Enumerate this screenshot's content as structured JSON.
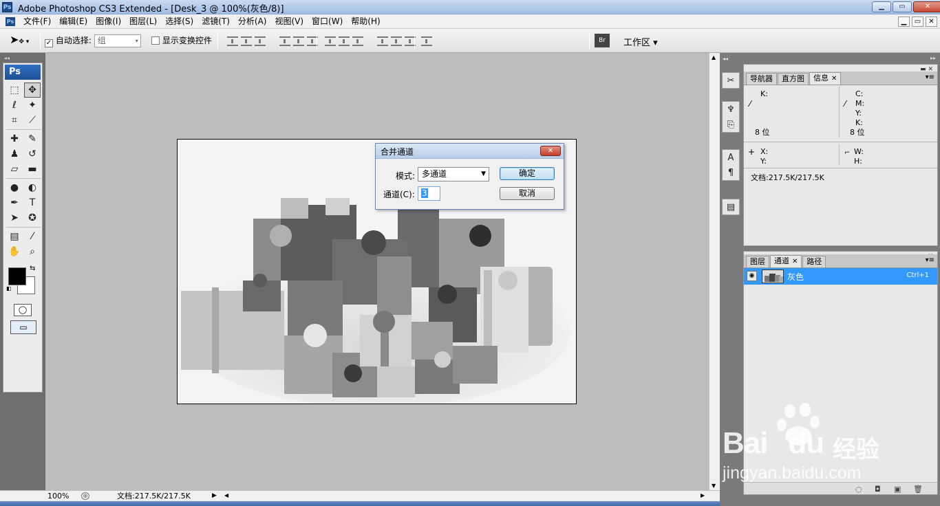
{
  "window": {
    "title": "Adobe Photoshop CS3 Extended - [Desk_3 @ 100%(灰色/8)]",
    "app_icon": "Ps",
    "buttons": {
      "minimize": "▁",
      "maximize": "▭",
      "close": "✕"
    }
  },
  "menubar": {
    "app_icon": "Ps",
    "items": [
      "文件(F)",
      "编辑(E)",
      "图像(I)",
      "图层(L)",
      "选择(S)",
      "滤镜(T)",
      "分析(A)",
      "视图(V)",
      "窗口(W)",
      "帮助(H)"
    ],
    "doc_buttons": [
      "▁",
      "▭",
      "✕"
    ]
  },
  "options": {
    "auto_select_label": "自动选择:",
    "auto_select_checked": "✓",
    "auto_select_value": "组",
    "show_transform_label": "显示变换控件",
    "workspace_label": "工作区 ▾"
  },
  "toolbox": {
    "header": "Ps",
    "tools": [
      {
        "name": "marquee",
        "glyph": "⬚"
      },
      {
        "name": "move",
        "glyph": "✥"
      },
      {
        "name": "lasso",
        "glyph": "ℓ"
      },
      {
        "name": "magic-wand",
        "glyph": "✦"
      },
      {
        "name": "crop",
        "glyph": "⌗"
      },
      {
        "name": "slice",
        "glyph": "⟋"
      },
      {
        "name": "healing-brush",
        "glyph": "✚"
      },
      {
        "name": "brush",
        "glyph": "✎"
      },
      {
        "name": "clone-stamp",
        "glyph": "♟"
      },
      {
        "name": "history-brush",
        "glyph": "↺"
      },
      {
        "name": "eraser",
        "glyph": "▱"
      },
      {
        "name": "gradient",
        "glyph": "▬"
      },
      {
        "name": "blur",
        "glyph": "●"
      },
      {
        "name": "dodge",
        "glyph": "◐"
      },
      {
        "name": "pen",
        "glyph": "✒"
      },
      {
        "name": "type",
        "glyph": "T"
      },
      {
        "name": "path-selection",
        "glyph": "➤"
      },
      {
        "name": "custom-shape",
        "glyph": "✪"
      },
      {
        "name": "notes",
        "glyph": "▤"
      },
      {
        "name": "eyedropper",
        "glyph": "⁄"
      },
      {
        "name": "hand",
        "glyph": "✋"
      },
      {
        "name": "zoom",
        "glyph": "⌕"
      }
    ],
    "foreground_color": "#000000",
    "background_color": "#ffffff"
  },
  "dialog": {
    "title": "合并通道",
    "mode_label": "模式:",
    "mode_value": "多通道",
    "channels_label": "通道(C):",
    "channels_value": "3",
    "ok_label": "确定",
    "cancel_label": "取消",
    "close_glyph": "✕"
  },
  "status": {
    "zoom": "100%",
    "doc_info": "文档:217.5K/217.5K"
  },
  "info_panel": {
    "tabs": [
      "导航器",
      "直方图",
      "信息"
    ],
    "active_tab": "信息",
    "left_k": "K:",
    "right_c": "C:",
    "right_m": "M:",
    "right_y": "Y:",
    "right_k": "K:",
    "bits_left": "8 位",
    "bits_right": "8 位",
    "x_label": "X:",
    "y_label": "Y:",
    "w_label": "W:",
    "h_label": "H:",
    "doc_info": "文档:217.5K/217.5K"
  },
  "channels_panel": {
    "tabs": [
      "图层",
      "通道",
      "路径"
    ],
    "active_tab": "通道",
    "channel_name": "灰色",
    "channel_shortcut": "Ctrl+1"
  },
  "watermark": {
    "logo_text": "Bai",
    "logo_text2": "du",
    "cn_text": "经验",
    "url": "jingyan.baidu.com"
  },
  "colors": {
    "selection_blue": "#3399ff",
    "canvas_gray": "#bdbdbd",
    "panel_gray": "#e8e8e8"
  }
}
